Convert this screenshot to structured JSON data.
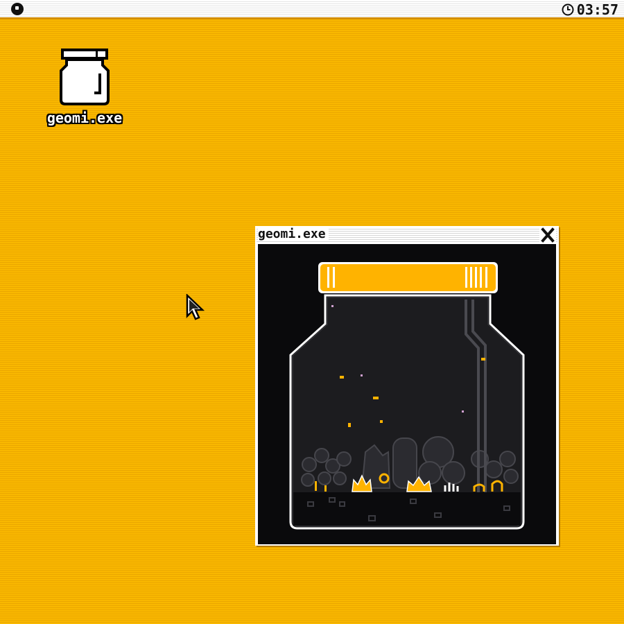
{
  "menubar": {
    "clock_time": "03:57"
  },
  "desktop": {
    "icons": [
      {
        "label": "geomi.exe",
        "icon": "jar-icon"
      }
    ]
  },
  "window": {
    "title": "geomi.exe",
    "close_glyph": "X"
  },
  "colors": {
    "accent": "#f9b800",
    "jar_lid": "#ffb300",
    "background": "#0a0a0c"
  }
}
